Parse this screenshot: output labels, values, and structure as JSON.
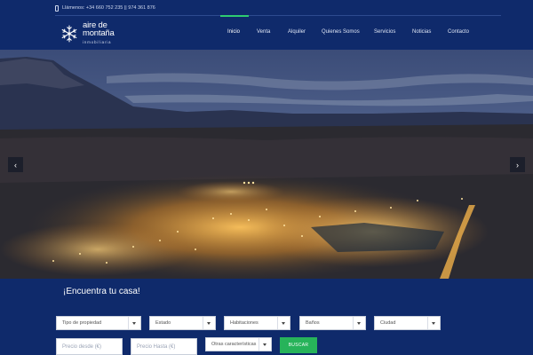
{
  "header": {
    "phone_text": "Llámenos: +34 660 752 235 || 974 361 876",
    "logo": {
      "line1": "aire de",
      "line2": "montaña",
      "line3": "inmobiliaria"
    },
    "nav": [
      {
        "label": "Inicio",
        "active": true
      },
      {
        "label": "Venta"
      },
      {
        "label": "Alquiler"
      },
      {
        "label": "Quienes Somos"
      },
      {
        "label": "Servicios"
      },
      {
        "label": "Noticias"
      },
      {
        "label": "Contacto"
      }
    ],
    "accent_color": "#2ecc71"
  },
  "slider": {
    "prev_icon": "‹",
    "next_icon": "›"
  },
  "search": {
    "title": "¡Encuentra tu casa!",
    "selects": [
      {
        "label": "Tipo de propiedad"
      },
      {
        "label": "Estado"
      },
      {
        "label": "Habitaciones"
      },
      {
        "label": "Baños"
      },
      {
        "label": "Ciudad"
      }
    ],
    "price_from_placeholder": "Precio desde (€)",
    "price_to_placeholder": "Precio Hasta (€)",
    "features_label": "Otras características",
    "submit_label": "BUSCAR"
  },
  "colors": {
    "background": "#0f2a6b",
    "button": "#27b35a"
  }
}
